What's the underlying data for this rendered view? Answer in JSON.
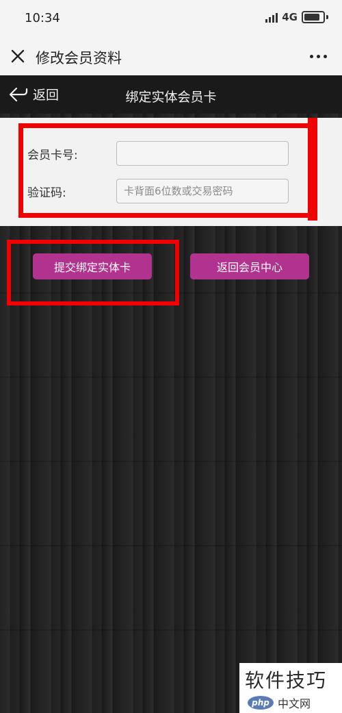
{
  "status_bar": {
    "time": "10:34",
    "network": "4G"
  },
  "nav_bar": {
    "title": "修改会员资料"
  },
  "page_header": {
    "back_label": "返回",
    "title": "绑定实体会员卡"
  },
  "form": {
    "card_number_label": "会员卡号:",
    "card_number_value": "",
    "verification_label": "验证码:",
    "verification_placeholder": "卡背面6位数或交易密码"
  },
  "buttons": {
    "submit_label": "提交绑定实体卡",
    "return_label": "返回会员中心"
  },
  "watermark": {
    "text": "软件技巧",
    "logo_php": "php",
    "logo_cn": "中文网"
  },
  "colors": {
    "accent_button": "#b2338f",
    "highlight": "#f00000",
    "panel_bg": "#f2f2f2",
    "page_bg": "#1b1b1b"
  }
}
